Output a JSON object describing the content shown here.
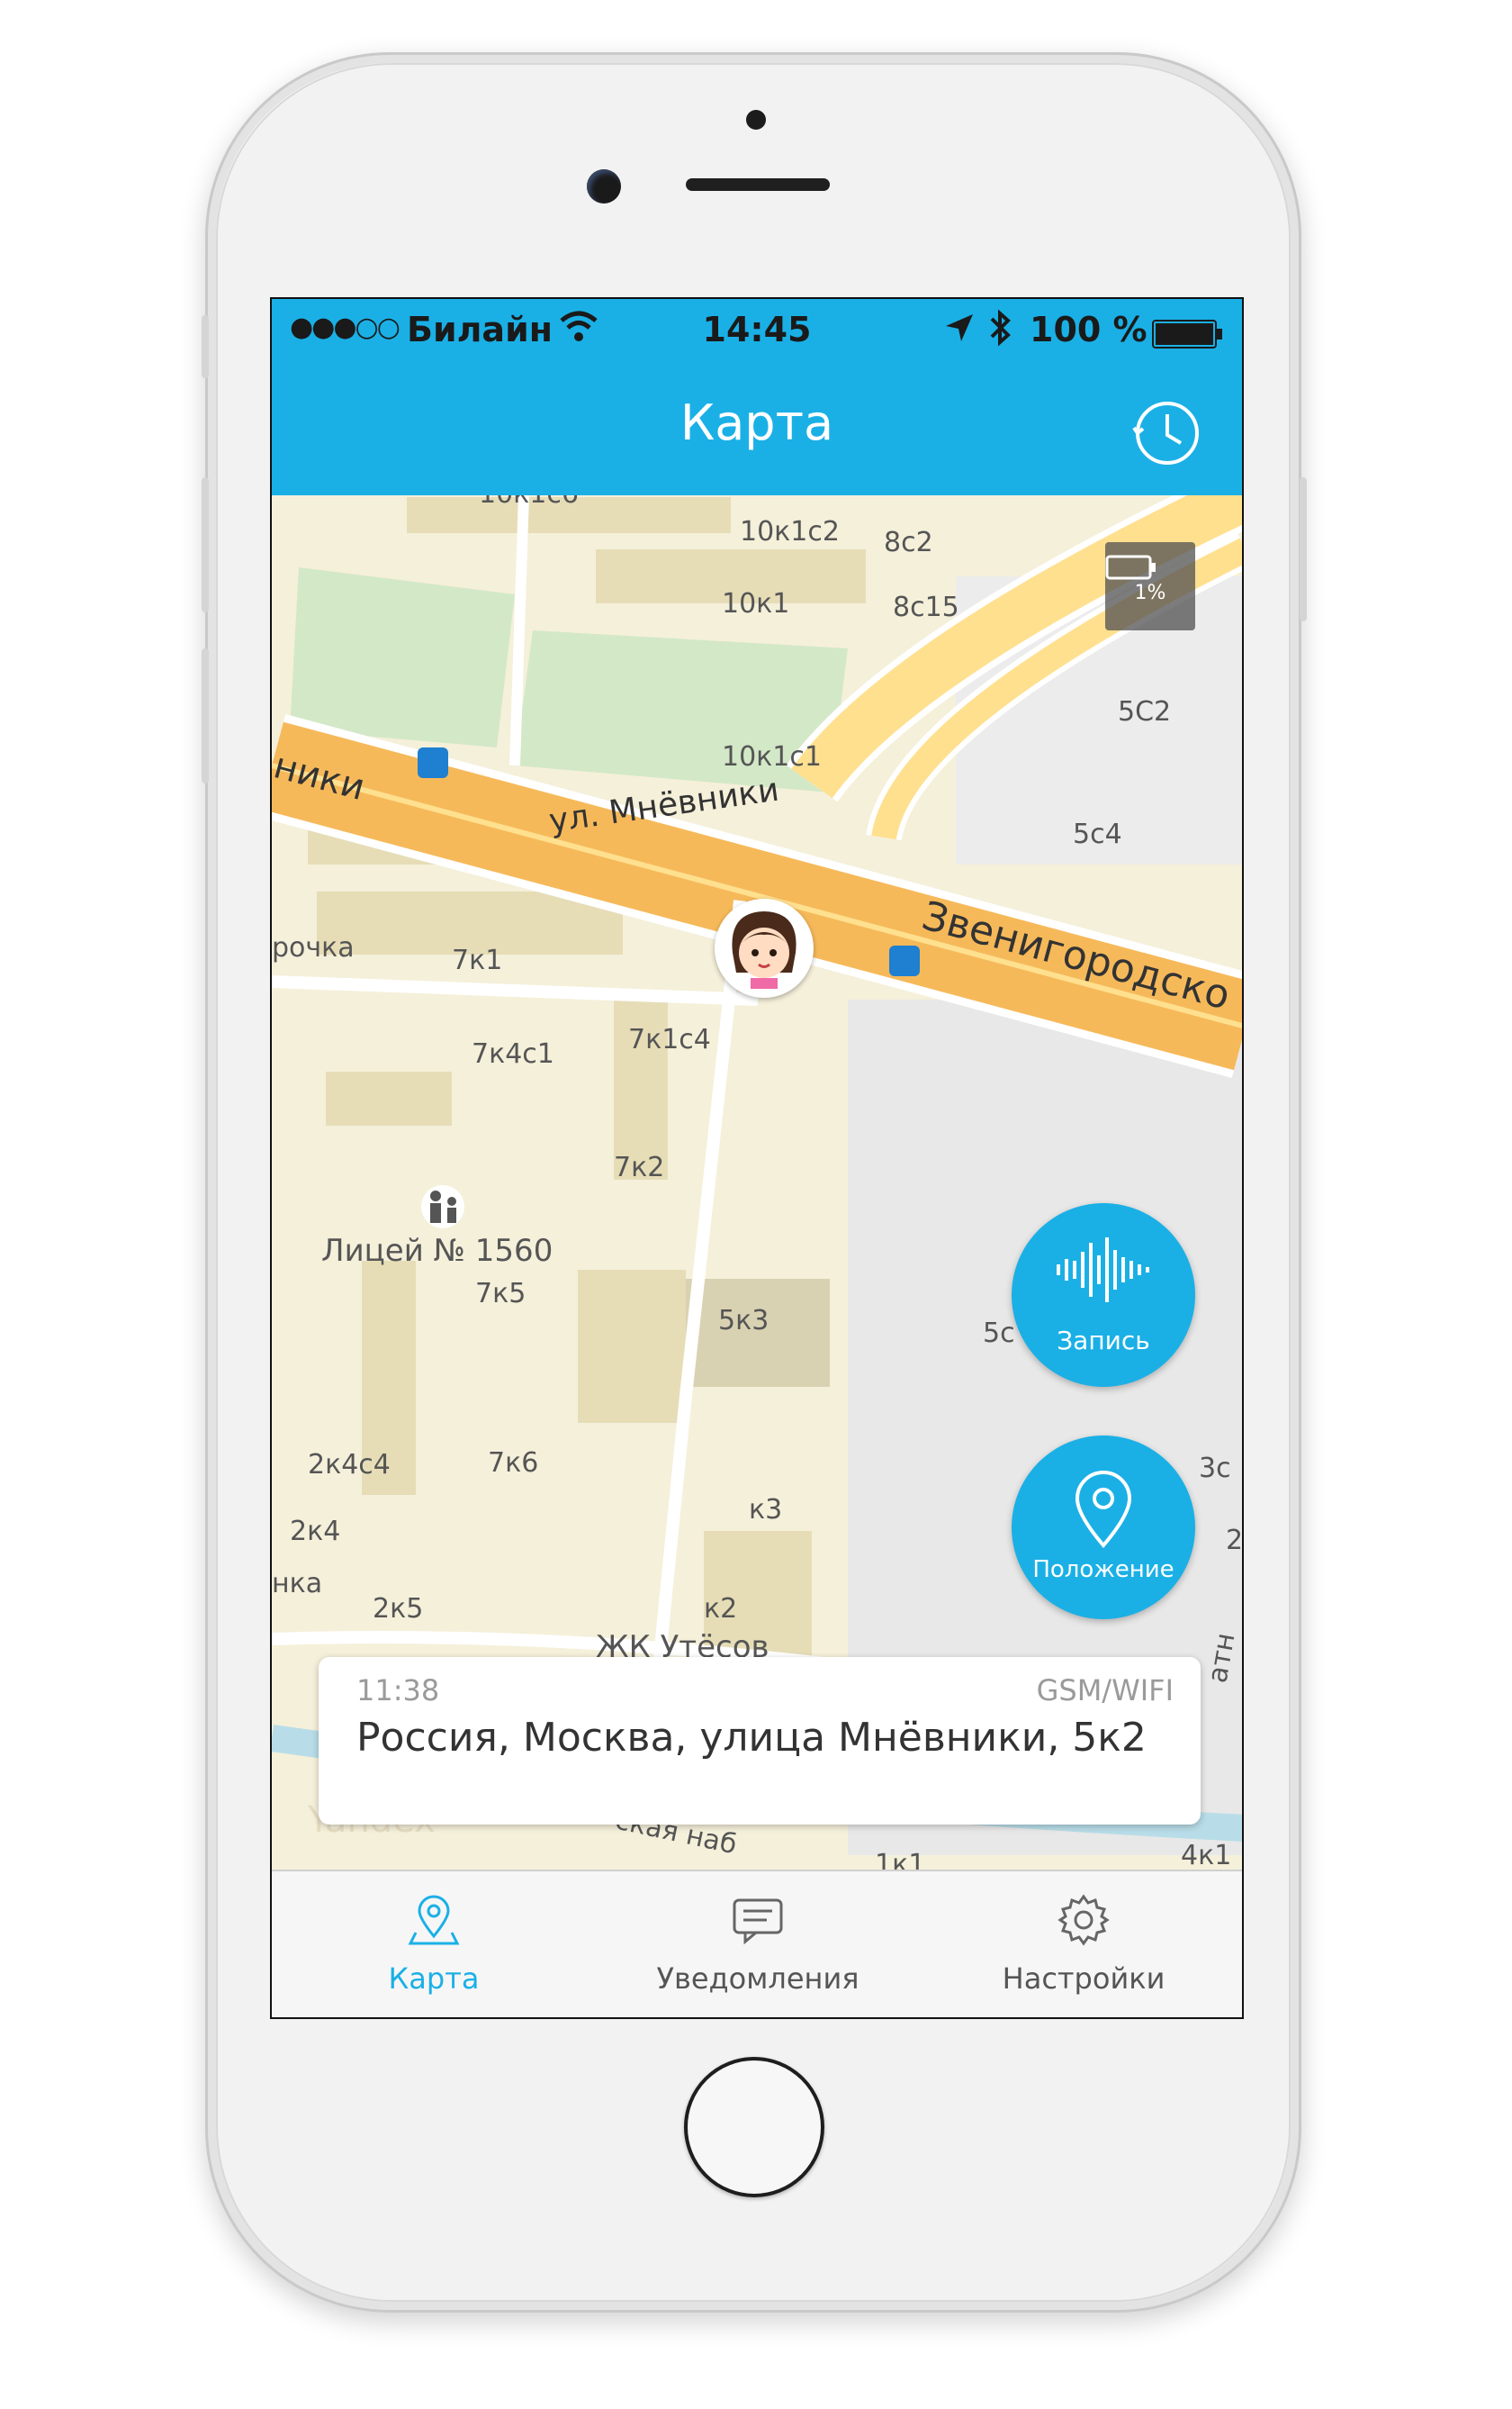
{
  "status_bar": {
    "signal": "●●●○○",
    "carrier": "Билайн",
    "time": "14:45",
    "battery_percent": "100 %"
  },
  "nav": {
    "title": "Карта",
    "history_icon": "clock-icon"
  },
  "map": {
    "battery_chip": "1%",
    "labels": {
      "b1": "10к1с2",
      "b2": "8с2",
      "b3": "10к1",
      "b4": "8с15",
      "b5": "5С2",
      "b6": "10к1с1",
      "b7": "5с4",
      "b8": "7к1",
      "b9": "7к4с1",
      "b10": "7к1с4",
      "b11": "7к2",
      "b12": "7к5",
      "b13": "5к3",
      "b14": "2к4с4",
      "b15": "7к6",
      "b16": "к3",
      "b17": "2к4",
      "b18": "2к5",
      "b19": "к2",
      "b20": "4к1",
      "b21": "1к1",
      "b22": "3с",
      "b23": "5с",
      "b24": "2",
      "b25": "10к1с6",
      "street1": "ул. Мнёвники",
      "street2": "Звенигородско",
      "street3": "ники",
      "street4": "рочка",
      "street5": "нка",
      "street6": "ская наб",
      "street7": "атн",
      "school": "Лицей № 1560",
      "complex": "ЖК Утёсов",
      "watermark": "Yandex"
    }
  },
  "actions": {
    "record_label": "Запись",
    "position_label": "Положение"
  },
  "location_card": {
    "time": "11:38",
    "source": "GSM/WIFI",
    "address": "Россия, Москва, улица Мнёвники, 5к2"
  },
  "tabs": [
    {
      "label": "Карта",
      "icon": "map-pin-icon",
      "active": true
    },
    {
      "label": "Уведомления",
      "icon": "chat-icon",
      "active": false
    },
    {
      "label": "Настройки",
      "icon": "gear-icon",
      "active": false
    }
  ],
  "colors": {
    "accent": "#1ab0e6",
    "map_background": "#f5f0da",
    "road": "#f6b95a",
    "park": "#d3e8c7"
  }
}
